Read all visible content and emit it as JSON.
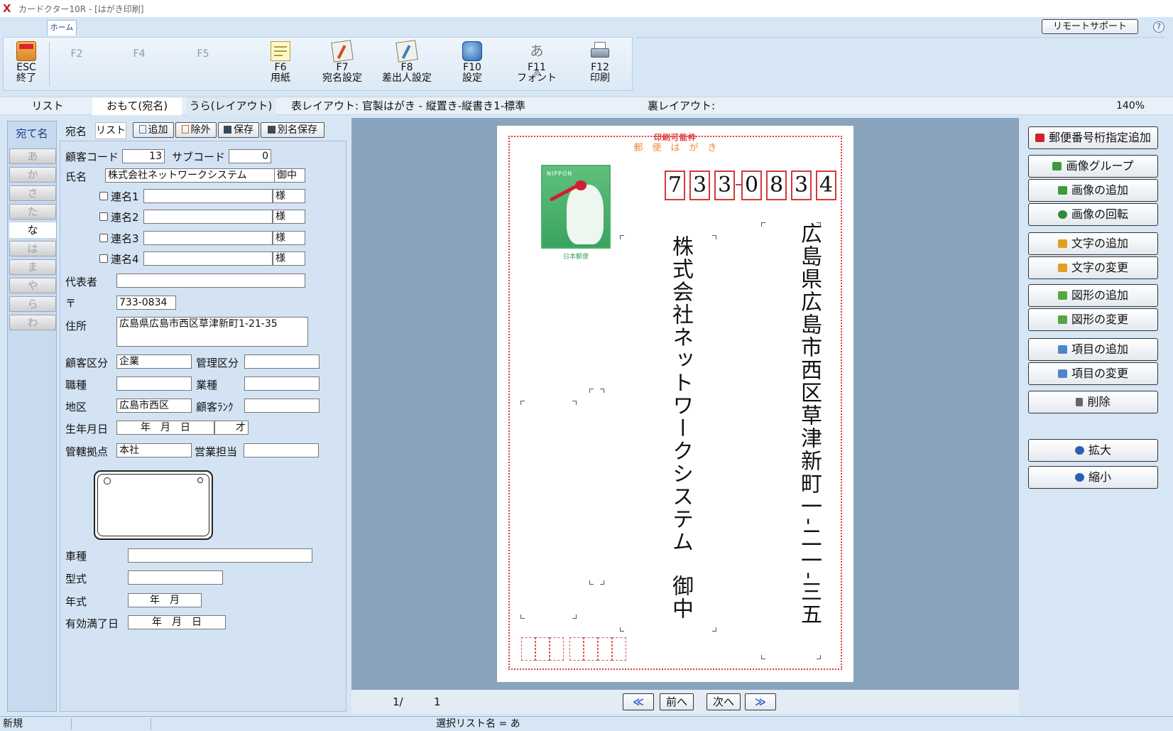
{
  "window": {
    "title": "カードクター10R - [はがき印刷]",
    "logo": "X"
  },
  "ribbon": {
    "tab": "ホーム",
    "remote_support": "リモートサポート",
    "help": "?",
    "buttons": [
      {
        "key": "ESC",
        "label": "終了",
        "icon": "exit-icon"
      },
      {
        "key": "F2",
        "label": ""
      },
      {
        "key": "F4",
        "label": ""
      },
      {
        "key": "F5",
        "label": ""
      },
      {
        "key": "F6",
        "label": "用紙",
        "icon": "paper-icon"
      },
      {
        "key": "F7",
        "label": "宛名設定",
        "icon": "address-setting-icon"
      },
      {
        "key": "F8",
        "label": "差出人設定",
        "icon": "sender-setting-icon"
      },
      {
        "key": "F10",
        "label": "設定",
        "icon": "settings-icon"
      },
      {
        "key": "F11",
        "label": "フォント",
        "icon": "font-icon"
      },
      {
        "key": "F12",
        "label": "印刷",
        "icon": "printer-icon"
      }
    ]
  },
  "infobar": {
    "tabs": [
      "リスト",
      "おもて(宛名)",
      "うら(レイアウト)"
    ],
    "front_layout": "表レイアウト: 官製はがき - 縦置き-縦書き1-標準",
    "back_layout": "裏レイアウト:",
    "zoom": "140%"
  },
  "left_tabs": {
    "header": "宛て名",
    "kana": [
      "あ",
      "か",
      "さ",
      "た",
      "な",
      "は",
      "ま",
      "や",
      "ら",
      "わ"
    ],
    "selected": 4
  },
  "form": {
    "subtabs": [
      "宛名",
      "リスト"
    ],
    "toolbar": {
      "add": "追加",
      "remove": "除外",
      "save": "保存",
      "save_as": "別名保存"
    },
    "customer_code_label": "顧客コード",
    "customer_code": "13",
    "sub_code_label": "サブコード",
    "sub_code": "0",
    "name_label": "氏名",
    "name": "株式会社ネットワークシステム",
    "name_honorific": "御中",
    "joint": [
      {
        "label": "連名1",
        "honorific": "様"
      },
      {
        "label": "連名2",
        "honorific": "様"
      },
      {
        "label": "連名3",
        "honorific": "様"
      },
      {
        "label": "連名4",
        "honorific": "様"
      }
    ],
    "representative_label": "代表者",
    "representative": "",
    "zip_label": "〒",
    "zip": "733-0834",
    "address_label": "住所",
    "address": "広島県広島市西区草津新町1-21-35",
    "customer_class_label": "顧客区分",
    "customer_class": "企業",
    "mgmt_class_label": "管理区分",
    "mgmt_class": "",
    "job_label": "職種",
    "job": "",
    "industry_label": "業種",
    "industry": "",
    "area_label": "地区",
    "area": "広島市西区",
    "rank_label": "顧客ﾗﾝｸ",
    "rank": "",
    "birth_label": "生年月日",
    "birth": "年　月　日",
    "age": "才",
    "base_label": "管轄拠点",
    "base": "本社",
    "sales_label": "営業担当",
    "sales": "",
    "car_label": "車種",
    "car": "",
    "model_label": "型式",
    "model": "",
    "year_label": "年式",
    "year": "年　月",
    "expiry_label": "有効満了日",
    "expiry": "年　月　日"
  },
  "postcard": {
    "header_small": "印刷可能枠",
    "header": "郵　便　は　が　き",
    "stamp_text": "NIPPON",
    "stamp_bottom": "日本郵便",
    "zip_digits": [
      "7",
      "3",
      "3",
      "0",
      "8",
      "3",
      "4"
    ],
    "address": "広島県広島市西区草津新町一-二一-三五",
    "recipient": "株式会社ネットワークシステム",
    "honorific": "御中"
  },
  "nav": {
    "page": "1/",
    "total": "1",
    "first": "≪",
    "prev": "前へ",
    "next": "次へ",
    "last": "≫"
  },
  "right_buttons": [
    {
      "label": "郵便番号桁指定追加",
      "color": "#d0222a"
    },
    {
      "label": "画像グループ",
      "color": "#3f9a3a"
    },
    {
      "label": "画像の追加",
      "color": "#3f9a3a"
    },
    {
      "label": "画像の回転",
      "color": "#2e8b3e"
    },
    {
      "label": "文字の追加",
      "color": "#e0a020"
    },
    {
      "label": "文字の変更",
      "color": "#e0a020"
    },
    {
      "label": "図形の追加",
      "color": "#56a83e"
    },
    {
      "label": "図形の変更",
      "color": "#56a83e"
    },
    {
      "label": "項目の追加",
      "color": "#4f86c6"
    },
    {
      "label": "項目の変更",
      "color": "#4f86c6"
    },
    {
      "label": "削除",
      "color": "#666666"
    },
    {
      "label": "拡大",
      "color": "#2a5fb0"
    },
    {
      "label": "縮小",
      "color": "#2a5fb0"
    }
  ],
  "statusbar": {
    "mode": "新規",
    "selected_list": "選択リスト名 = あ"
  }
}
